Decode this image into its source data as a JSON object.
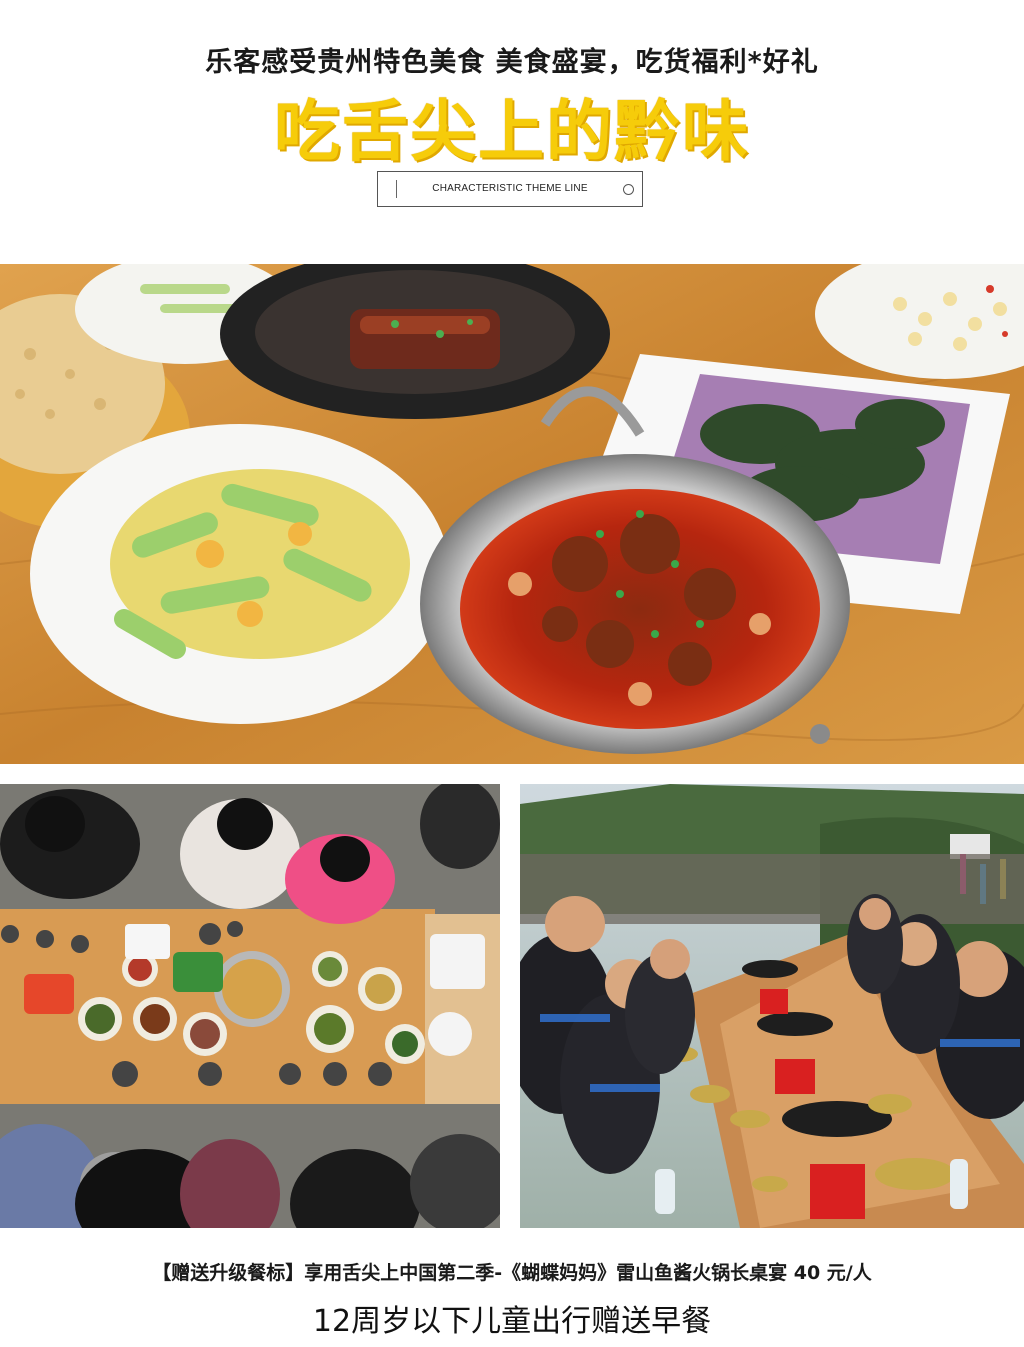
{
  "header": {
    "subtitle": "乐客感受贵州特色美食 美食盛宴，吃货福利*好礼",
    "headline": "吃舌尖上的黔味",
    "theme_tag": "CHARACTERISTIC THEME LINE"
  },
  "photos": {
    "main": {
      "alt": "food-dishes-photo"
    },
    "left": {
      "alt": "family-table-overhead-photo"
    },
    "right": {
      "alt": "long-table-banquet-photo"
    }
  },
  "footer": {
    "offer_line": "【赠送升级餐标】享用舌尖上中国第二季-《蝴蝶妈妈》雷山鱼酱火锅长桌宴 40 元/人",
    "children_line": "12周岁以下儿童出行赠送早餐"
  },
  "colors": {
    "headline": "#f6cc0a",
    "table_wood": "#c98a3c",
    "soup_red": "#b3200f"
  }
}
